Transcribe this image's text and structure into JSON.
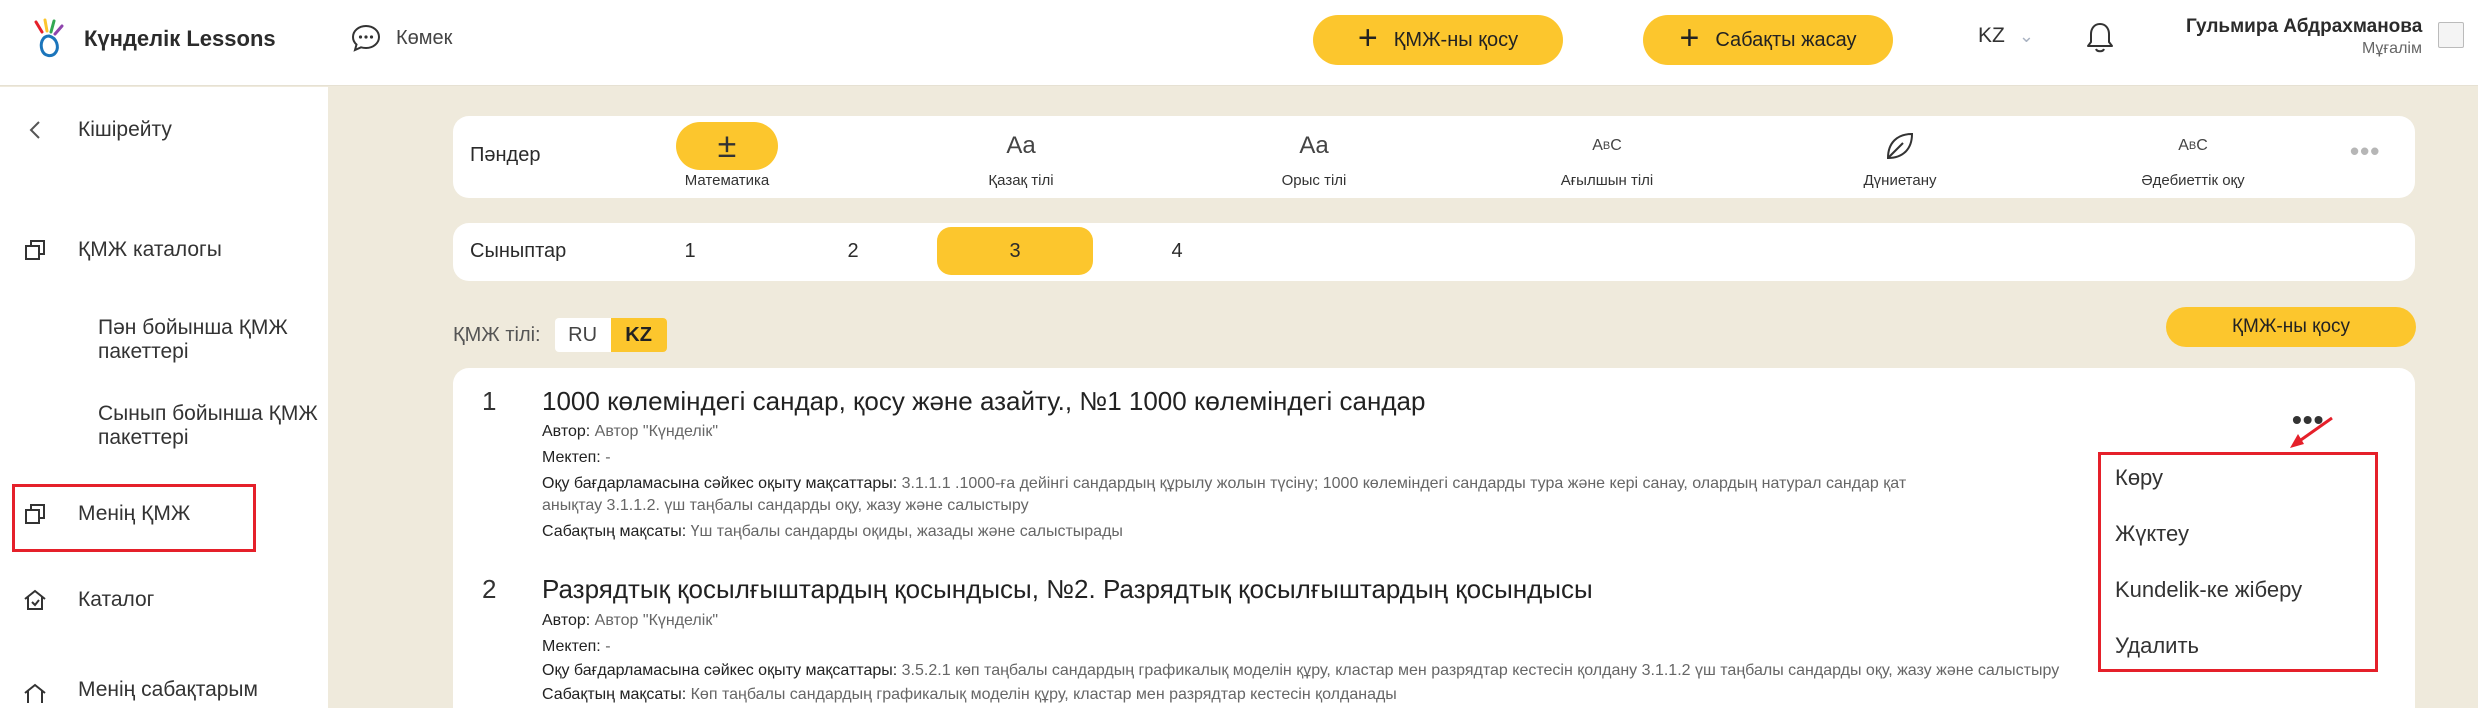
{
  "header": {
    "brand": "Күнделік Lessons",
    "help_label": "Көмек",
    "add_kmzh_label": "ҚМЖ-ны қосу",
    "create_lesson_label": "Сабақты жасау",
    "lang": "KZ",
    "user_name": "Гульмира Абдрахманова",
    "user_role": "Мұғалім"
  },
  "sidebar": {
    "collapse_label": "Кішірейту",
    "catalog_label": "ҚМЖ каталогы",
    "sub_subject_packages": "Пән бойынша ҚМЖ пакеттері",
    "sub_class_packages": "Сынып бойынша ҚМЖ пакеттері",
    "my_kmzh_label": "Менің ҚМЖ",
    "catalog2_label": "Каталог",
    "my_lessons_label": "Менің сабақтарым"
  },
  "subjects": {
    "label": "Пәндер",
    "items": [
      "Математика",
      "Қазақ тілі",
      "Орыс тілі",
      "Ағылшын тілі",
      "Дүниетану",
      "Әдебиеттік оқу"
    ],
    "icons": [
      "±",
      "Aa",
      "Aa",
      "AʙC",
      "leaf-icon",
      "AʙC"
    ]
  },
  "grades": {
    "label": "Сыныптар",
    "items": [
      "1",
      "2",
      "3",
      "4"
    ],
    "selected": "3"
  },
  "kmzh_lang": {
    "label": "ҚМЖ тілі:",
    "options": [
      "RU",
      "KZ"
    ],
    "selected": "KZ"
  },
  "add_button_label": "ҚМЖ-ны қосу",
  "items": [
    {
      "num": "1",
      "title": "1000 көлеміндегі сандар, қосу және азайту., №1 1000 көлеміндегі сандар",
      "author_label": "Автор:",
      "author": "Автор \"Күнделік\"",
      "school_label": "Мектеп:",
      "school": "-",
      "goals_label": "Оқу бағдарламасына сәйкес оқыту мақсаттары:",
      "goals": "3.1.1.1 .1000-ға дейінгі сандардың құрылу жолын түсіну; 1000 көлеміндегі сандарды тура және кері санау, олардың натурал сандар қат",
      "goals_cont": "анықтау 3.1.1.2. үш таңбалы сандарды оқу, жазу және салыстыру",
      "aim_label": "Сабақтың мақсаты:",
      "aim": "Үш таңбалы сандарды оқиды, жазады және салыстырады"
    },
    {
      "num": "2",
      "title": "Разрядтық қосылғыштардың қосындысы, №2. Разрядтық қосылғыштардың қосындысы",
      "author_label": "Автор:",
      "author": "Автор \"Күнделік\"",
      "school_label": "Мектеп:",
      "school": "-",
      "goals_label": "Оқу бағдарламасына сәйкес оқыту мақсаттары:",
      "goals": "3.5.2.1 көп таңбалы сандардың графикалық моделін құру, кластар мен разрядтар кестесін қолдану 3.1.1.2 үш таңбалы сандарды оқу, жазу және салыстыру",
      "aim_label": "Сабақтың мақсаты:",
      "aim": "Көп таңбалы сандардың графикалық моделін құру, кластар мен разрядтар кестесін қолданады"
    }
  ],
  "context_menu": {
    "items": [
      "Көру",
      "Жүктеу",
      "Kundelik-ке жіберу",
      "Удалить"
    ]
  },
  "colors": {
    "accent": "#fcc62d",
    "highlight": "#e5202a",
    "background": "#efeadc"
  }
}
